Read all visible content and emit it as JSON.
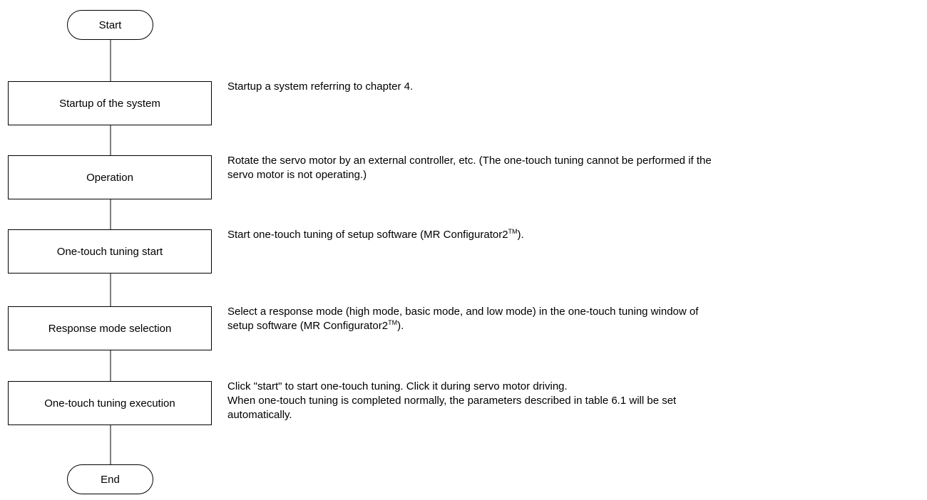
{
  "flowchart": {
    "start_label": "Start",
    "end_label": "End",
    "steps": [
      {
        "label": "Startup of the system",
        "note_lines": [
          [
            "Startup a system referring to chapter 4."
          ]
        ]
      },
      {
        "label": "Operation",
        "note_lines": [
          [
            "Rotate the servo motor by an external controller, etc. (The one-touch tuning cannot be performed if the"
          ],
          [
            "servo motor is not operating.)"
          ]
        ]
      },
      {
        "label": "One-touch tuning start",
        "note_lines": [
          [
            "Start one-touch tuning of setup software (MR Configurator2",
            "TM",
            ")."
          ]
        ]
      },
      {
        "label": "Response mode selection",
        "note_lines": [
          [
            "Select a response mode (high mode, basic mode, and low mode) in the one-touch tuning window of"
          ],
          [
            "setup software (MR Configurator2",
            "TM",
            ")."
          ]
        ]
      },
      {
        "label": "One-touch tuning execution",
        "note_lines": [
          [
            "Click \"start\" to start one-touch tuning. Click it during servo motor driving."
          ],
          [
            "When one-touch tuning is completed normally, the parameters described in table 6.1 will be set"
          ],
          [
            "automatically."
          ]
        ]
      }
    ]
  }
}
